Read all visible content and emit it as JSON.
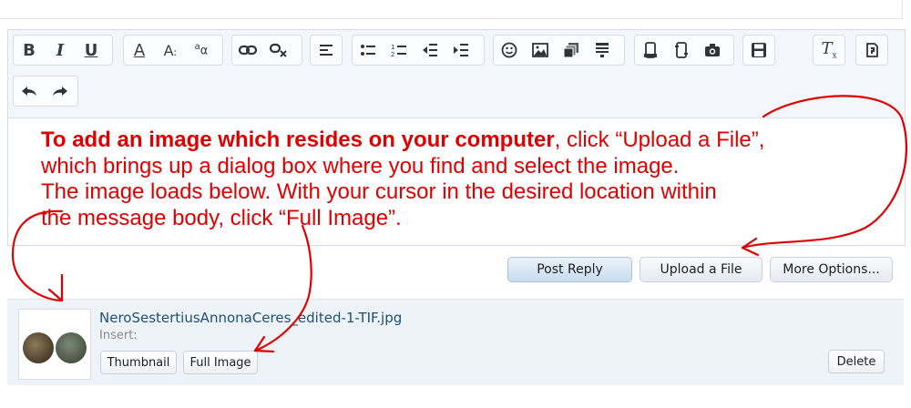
{
  "toolbar": {
    "icons": [
      "bold-icon",
      "italic-icon",
      "underline-icon",
      "font-color-icon",
      "font-size-icon",
      "font-family-icon",
      "link-icon",
      "unlink-icon",
      "align-icon",
      "bullet-list-icon",
      "numbered-list-icon",
      "outdent-icon",
      "indent-icon",
      "smilie-icon",
      "image-icon",
      "media-icon",
      "quote-icon",
      "code-icon",
      "php-icon",
      "html-icon",
      "camera-icon",
      "save-draft-icon",
      "remove-format-icon",
      "toggle-bbcode-icon",
      "undo-icon",
      "redo-icon"
    ]
  },
  "instructions": {
    "line1_bold": "To add an image which resides on your computer",
    "line1_rest": ", click “Upload a File”,",
    "line2": "which brings up a dialog box where you find and select the image.",
    "line3": "The image loads below.  With your cursor in the desired location within",
    "line4": "the message body, click “Full Image”."
  },
  "actions": {
    "post_reply": "Post Reply",
    "upload_file": "Upload a File",
    "more_options": "More Options..."
  },
  "attachment": {
    "filename": "NeroSestertiusAnnonaCeres_edited-1-TIF.jpg",
    "insert_label": "Insert:",
    "thumbnail_button": "Thumbnail",
    "full_image_button": "Full Image",
    "delete_button": "Delete"
  },
  "annotation_color": "#e00000"
}
